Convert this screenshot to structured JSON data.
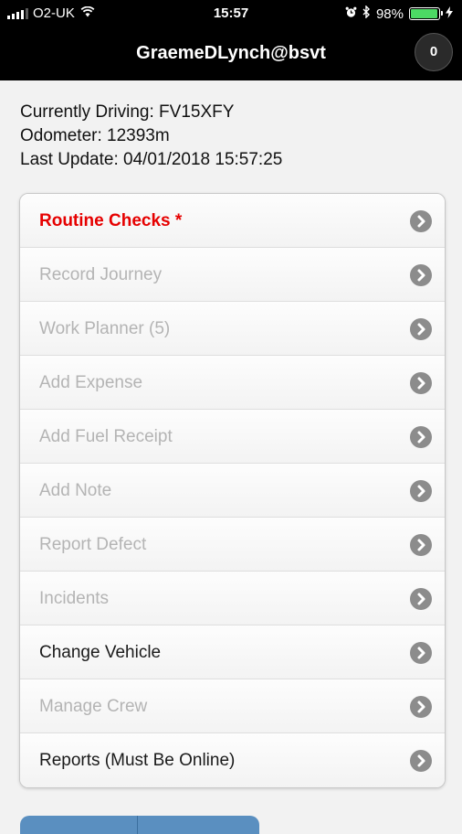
{
  "status_bar": {
    "carrier": "O2-UK",
    "time": "15:57",
    "battery": "98%",
    "battery_level": 0.98,
    "icons": [
      "signal-icon",
      "wifi-icon",
      "alarm-icon",
      "bluetooth-icon",
      "battery-icon",
      "charging-icon"
    ]
  },
  "header": {
    "title": "GraemeDLynch@bsvt",
    "badge_count": "0"
  },
  "info": {
    "currently_driving": "Currently Driving: FV15XFY",
    "odometer": "Odometer: 12393m",
    "last_update": "Last Update: 04/01/2018 15:57:25"
  },
  "menu": {
    "items": [
      {
        "label": "Routine Checks *",
        "state": "alert"
      },
      {
        "label": "Record Journey",
        "state": "disabled"
      },
      {
        "label": "Work Planner (5)",
        "state": "disabled"
      },
      {
        "label": "Add Expense",
        "state": "disabled"
      },
      {
        "label": "Add Fuel Receipt",
        "state": "disabled"
      },
      {
        "label": "Add Note",
        "state": "disabled"
      },
      {
        "label": "Report Defect",
        "state": "disabled"
      },
      {
        "label": "Incidents",
        "state": "disabled"
      },
      {
        "label": "Change Vehicle",
        "state": "active"
      },
      {
        "label": "Manage Crew",
        "state": "disabled"
      },
      {
        "label": "Reports (Must Be Online)",
        "state": "active"
      }
    ]
  },
  "colors": {
    "alert": "#e60000",
    "disabled": "#b4b4b4",
    "active": "#1a1a1a",
    "header_bg": "#000000",
    "battery_green": "#4cd964",
    "bottom_button": "#5a8fc0"
  }
}
